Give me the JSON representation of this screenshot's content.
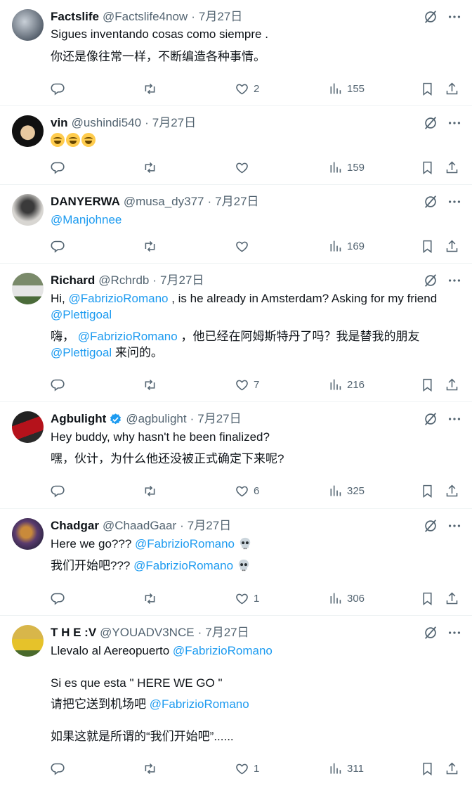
{
  "replies": [
    {
      "name": "Factslife",
      "handle": "@Factslife4now",
      "time": "7月27日",
      "line1": "Sigues inventando cosas como siempre .",
      "line2": "你还是像往常一样，不断编造各种事情。",
      "likes": "2",
      "views": "155"
    },
    {
      "name": "vin",
      "handle": "@ushindi540",
      "time": "7月27日",
      "likes": "",
      "views": "159"
    },
    {
      "name": "DANYERWA",
      "handle": "@musa_dy377",
      "time": "7月27日",
      "mention": "@Manjohnee",
      "likes": "",
      "views": "169"
    },
    {
      "name": "Richard",
      "handle": "@Rchrdb",
      "time": "7月27日",
      "l1a": "Hi, ",
      "l1m": "@FabrizioRomano",
      "l1b": " , is he already in Amsterdam? Asking for my friend",
      "l2m": "@Plettigoal",
      "l3a": "嗨， ",
      "l3m": "@FabrizioRomano",
      "l3b": " ，他已经在阿姆斯特丹了吗？我是替我的朋友",
      "l4m": "@Plettigoal",
      "l4b": " 来问的。",
      "likes": "7",
      "views": "216"
    },
    {
      "name": "Agbulight",
      "handle": "@agbulight",
      "time": "7月27日",
      "line1": "Hey buddy, why hasn't he been finalized?",
      "line2": "嘿，伙计，为什么他还没被正式确定下来呢?",
      "likes": "6",
      "views": "325"
    },
    {
      "name": "Chadgar",
      "handle": "@ChaadGaar",
      "time": "7月27日",
      "l1a": "Here we go??? ",
      "l1m": "@FabrizioRomano",
      "l2a": "我们开始吧??? ",
      "l2m": "@FabrizioRomano",
      "likes": "1",
      "views": "306"
    },
    {
      "name": "T H E :V",
      "handle": "@YOUADV3NCE",
      "time": "7月27日",
      "l1a": "Llevalo al Aereopuerto ",
      "l1m": "@FabrizioRomano",
      "l2a": "Si es que esta \" HERE WE GO \"",
      "l3a": "请把它送到机场吧 ",
      "l3m": "@FabrizioRomano",
      "l4a": "如果这就是所谓的“我们开始吧”......",
      "likes": "1",
      "views": "311"
    }
  ],
  "dot": "·",
  "icons": {
    "reply": "reply-icon",
    "retweet": "retweet-icon",
    "like": "like-icon",
    "views": "views-icon",
    "bookmark": "bookmark-icon",
    "share": "share-icon",
    "grok": "grok-icon",
    "more": "more-icon",
    "verified": "verified-badge-icon"
  },
  "colors": {
    "accent": "#1d9bf0",
    "secondary_text": "#536471",
    "divider": "#eff3f4"
  }
}
